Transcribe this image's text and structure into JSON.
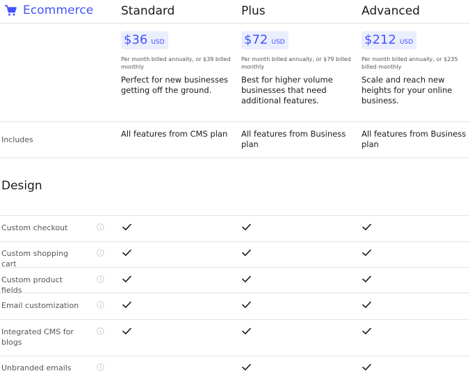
{
  "brand": {
    "label": "Ecommerce",
    "icon": "cart-icon",
    "accent": "#4353ff"
  },
  "plans": [
    {
      "name": "Standard",
      "price": "$36",
      "currency": "USD",
      "billing": "Per month billed annually, or $39 billed monthly",
      "description": "Perfect for new businesses getting off the ground."
    },
    {
      "name": "Plus",
      "price": "$72",
      "currency": "USD",
      "billing": "Per month billed annually, or $79 billed monthly",
      "description": "Best for higher volume businesses that need additional features."
    },
    {
      "name": "Advanced",
      "price": "$212",
      "currency": "USD",
      "billing": "Per month billed annually, or $235 billed monthly",
      "description": "Scale and reach new heights for your online business."
    }
  ],
  "includes": {
    "label": "Includes",
    "values": [
      "All features from CMS plan",
      "All features from Business plan",
      "All features from Business plan"
    ]
  },
  "section": {
    "title": "Design"
  },
  "features": [
    {
      "label": "Custom checkout",
      "included": [
        true,
        true,
        true
      ]
    },
    {
      "label": "Custom shopping cart",
      "included": [
        true,
        true,
        true
      ]
    },
    {
      "label": "Custom product fields",
      "included": [
        true,
        true,
        true
      ]
    },
    {
      "label": "Email customization",
      "included": [
        true,
        true,
        true
      ]
    },
    {
      "label": "Integrated CMS for blogs",
      "included": [
        true,
        true,
        true
      ]
    },
    {
      "label": "Unbranded emails",
      "included": [
        false,
        true,
        true
      ]
    }
  ]
}
